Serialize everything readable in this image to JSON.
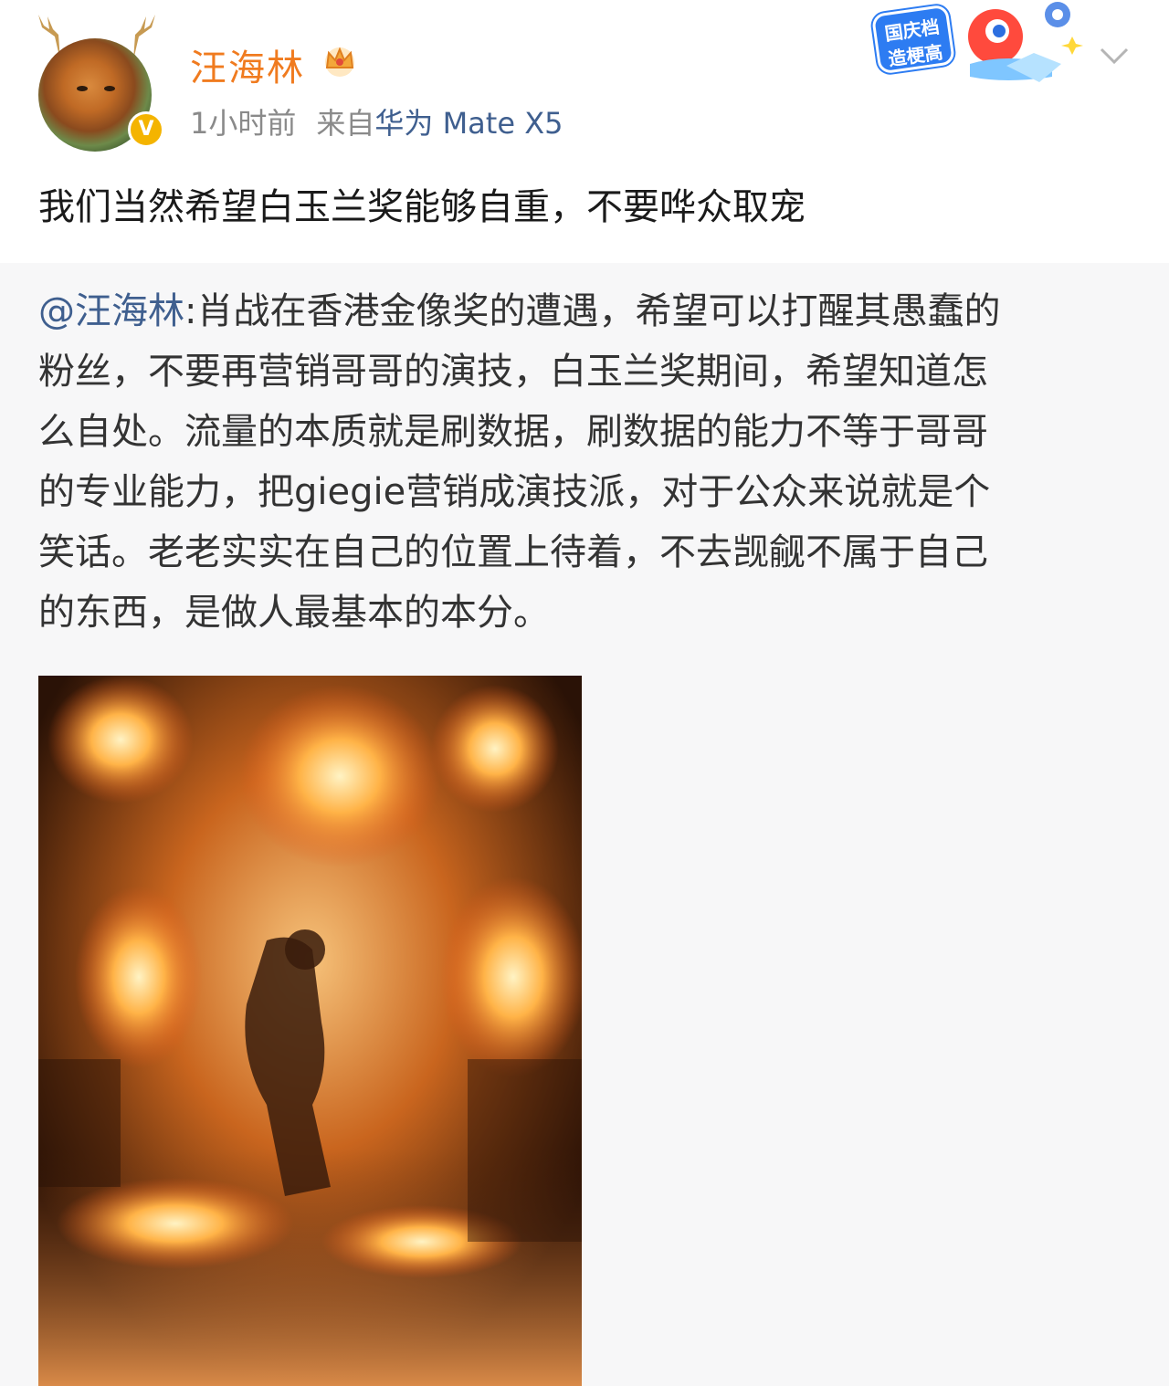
{
  "post": {
    "author": "汪海林",
    "time": "1小时前",
    "source_prefix": "来自",
    "device": "华为 Mate X5",
    "text": "我们当然希望白玉兰奖能够自重，不要哗众取宠",
    "sticker": {
      "line1": "国庆档",
      "line2": "造梗高手"
    },
    "icons": {
      "verified": "verified-badge-icon",
      "crown": "crown-icon",
      "menu": "chevron-down-icon"
    }
  },
  "retweet": {
    "mention": "@汪海林",
    "lines": [
      ":肖战在香港金像奖的遭遇，希望可以打醒其愚蠢的",
      "粉丝，不要再营销哥哥的演技，白玉兰奖期间，希望知道怎",
      "么自处。流量的本质就是刷数据，刷数据的能力不等于哥哥",
      "的专业能力，把giegie营销成演技派，对于公众来说就是个",
      "笑话。老老实实在自己的位置上待着，不去觊觎不属于自己",
      "的东西，是做人最基本的本分。"
    ]
  },
  "colors": {
    "username": "#f07b1f",
    "link": "#3f5f8f",
    "meta": "#8a8a8a",
    "retweet_bg": "#f7f7f8"
  }
}
